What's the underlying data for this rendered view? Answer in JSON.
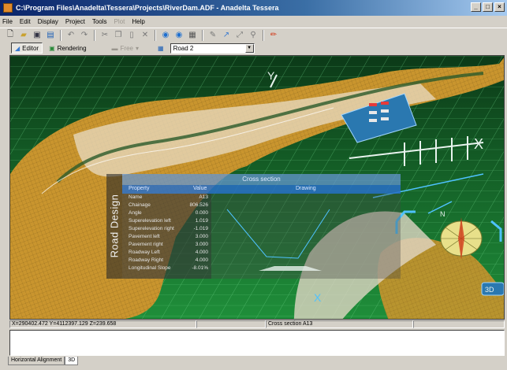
{
  "window": {
    "title": "C:\\Program Files\\Anadelta\\Tessera\\Projects\\RiverDam.ADF - Anadelta Tessera",
    "controls": [
      "minimize-icon",
      "maximize-icon",
      "close-icon"
    ],
    "accent": "#0a246a"
  },
  "menu": [
    {
      "label": "File",
      "enabled": true
    },
    {
      "label": "Edit",
      "enabled": true
    },
    {
      "label": "Display",
      "enabled": true
    },
    {
      "label": "Project",
      "enabled": true
    },
    {
      "label": "Tools",
      "enabled": true
    },
    {
      "label": "Plot",
      "enabled": false
    },
    {
      "label": "Help",
      "enabled": true
    }
  ],
  "toolbar": {
    "icons": [
      "new-icon",
      "open-icon",
      "save-icon",
      "properties-icon",
      "undo-icon",
      "redo-icon",
      "cut-icon",
      "copy-icon",
      "paste-icon",
      "delete-icon",
      "nav-back-icon",
      "nav-forward-icon",
      "export-icon",
      "measure-icon",
      "pick-icon",
      "zoom-icon",
      "search-icon",
      "pencil-icon"
    ]
  },
  "modes": {
    "editor": "Editor",
    "rendering": "Rendering",
    "free": "Free",
    "road_select": "Road 2"
  },
  "viewport": {
    "axis_y": "Y",
    "axis_x": "X",
    "grid_color": "#1f8f3a",
    "terrain_color": "#c9952e",
    "cross_section": {
      "title": "Cross section",
      "side_label": "Road Design",
      "columns": [
        "Property",
        "Value",
        "Drawing"
      ],
      "rows": [
        {
          "name": "Name",
          "value": "A13"
        },
        {
          "name": "Chainage",
          "value": "806.526"
        },
        {
          "name": "Angle",
          "value": "0.000"
        },
        {
          "name": "Superelevation left",
          "value": "1.019"
        },
        {
          "name": "Superelevation right",
          "value": "-1.019"
        },
        {
          "name": "Pavement left",
          "value": "3.000"
        },
        {
          "name": "Pavement right",
          "value": "3.000"
        },
        {
          "name": "Roadway Left",
          "value": "4.000"
        },
        {
          "name": "Roadway Right",
          "value": "4.000"
        },
        {
          "name": "Longitudinal Slope",
          "value": "-8.01%"
        }
      ]
    }
  },
  "status": {
    "coords": "X=290402.472  Y=4112397.129  Z=239.658",
    "section": "Cross section A13"
  },
  "bottom_tabs": [
    "Horizontal Alignment",
    "3D"
  ]
}
